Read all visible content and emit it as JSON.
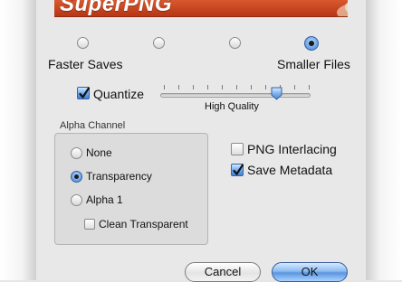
{
  "banner": {
    "title": "SuperPNG"
  },
  "compression": {
    "left_label": "Faster Saves",
    "right_label": "Smaller Files",
    "options_count": 4,
    "selected_index": 3
  },
  "quantize": {
    "label": "Quantize",
    "checked": true,
    "slider_caption": "High Quality",
    "slider_value_fraction": 0.75
  },
  "alpha_channel": {
    "title": "Alpha Channel",
    "options": [
      {
        "label": "None",
        "selected": false
      },
      {
        "label": "Transparency",
        "selected": true
      },
      {
        "label": "Alpha 1",
        "selected": false
      }
    ],
    "clean_transparent": {
      "label": "Clean Transparent",
      "checked": false
    }
  },
  "options": {
    "png_interlacing": {
      "label": "PNG Interlacing",
      "checked": false
    },
    "save_metadata": {
      "label": "Save Metadata",
      "checked": true
    }
  },
  "buttons": {
    "cancel": "Cancel",
    "ok": "OK"
  },
  "colors": {
    "accent": "#3f80d6",
    "banner": "#c84523"
  }
}
